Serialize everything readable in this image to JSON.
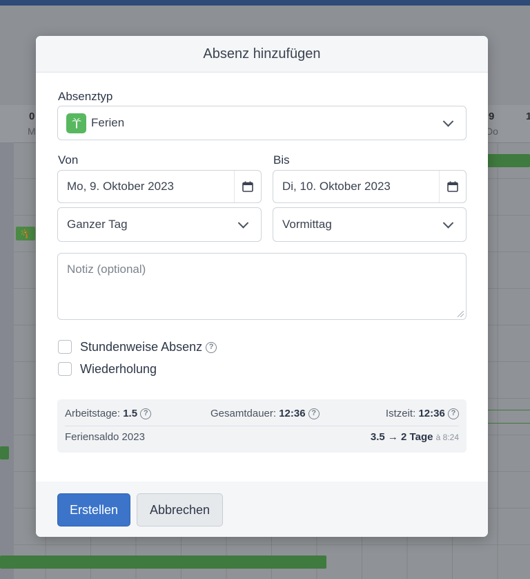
{
  "background": {
    "day_numbers": [
      "0",
      "9",
      "1"
    ],
    "day_abbrevs": [
      "M",
      "Do"
    ],
    "ferien_glyph": "🌴"
  },
  "modal": {
    "title": "Absenz hinzufügen",
    "absence_type": {
      "label": "Absenztyp",
      "value": "Ferien",
      "icon": "palm-tree-icon",
      "icon_color": "#58b85f"
    },
    "from": {
      "label": "Von",
      "date": "Mo, 9. Oktober 2023",
      "period": "Ganzer Tag"
    },
    "to": {
      "label": "Bis",
      "date": "Di, 10. Oktober 2023",
      "period": "Vormittag"
    },
    "note": {
      "placeholder": "Notiz (optional)"
    },
    "options": {
      "hourly": "Stundenweise Absenz",
      "repeat": "Wiederholung"
    },
    "summary": {
      "workdays_label": "Arbeitstage:",
      "workdays_value": "1.5",
      "total_label": "Gesamtdauer:",
      "total_value": "12:36",
      "actual_label": "Istzeit:",
      "actual_value": "12:36",
      "balance_label": "Feriensaldo 2023",
      "balance_value": "3.5 → 2 Tage",
      "balance_note": "à 8:24"
    },
    "buttons": {
      "create": "Erstellen",
      "cancel": "Abbrechen"
    },
    "help_glyph": "?"
  },
  "colors": {
    "primary": "#3b74c9",
    "ferien_green": "#58b85f"
  }
}
